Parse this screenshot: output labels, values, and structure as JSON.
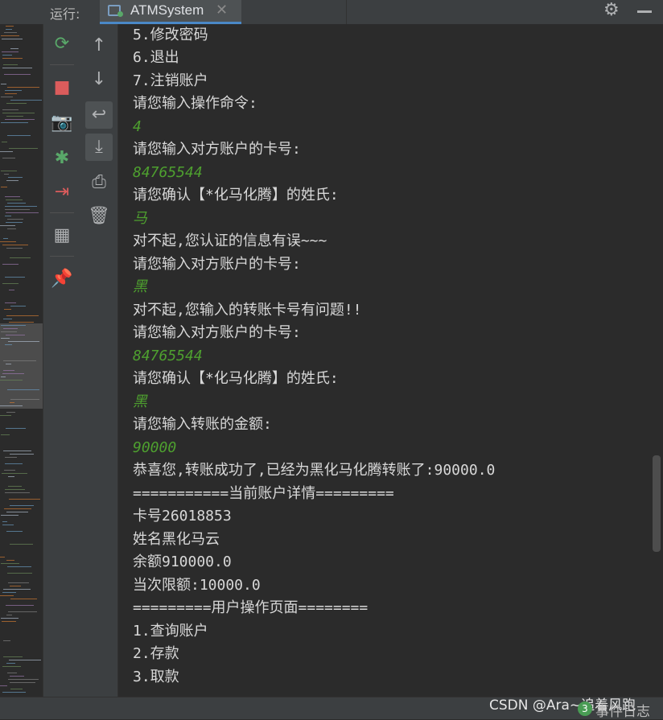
{
  "toolbar": {
    "run_label": "运行:",
    "tab_title": "ATMSystem",
    "tab_close": "✕"
  },
  "left_tools": [
    {
      "name": "rerun-icon",
      "glyph": "⟳",
      "color": "#59a869"
    },
    {
      "name": "stop-icon",
      "glyph": "■",
      "color": "#db5c5c"
    },
    {
      "name": "camera-icon",
      "glyph": "📷",
      "color": "#afb1b3"
    },
    {
      "name": "debug-icon",
      "glyph": "✱",
      "color": "#59a869"
    },
    {
      "name": "exit-icon",
      "glyph": "⇥",
      "color": "#db5c5c"
    },
    {
      "name": "layout-icon",
      "glyph": "▦",
      "color": "#afb1b3"
    },
    {
      "name": "pin-icon",
      "glyph": "📌",
      "color": "#afb1b3"
    }
  ],
  "right_tools": [
    {
      "name": "arrow-up-icon",
      "glyph": "↑"
    },
    {
      "name": "arrow-down-icon",
      "glyph": "↓"
    },
    {
      "name": "soft-wrap-icon",
      "glyph": "↩"
    },
    {
      "name": "scroll-to-end-icon",
      "glyph": "⤓"
    },
    {
      "name": "print-icon",
      "glyph": "⎙"
    },
    {
      "name": "trash-icon",
      "glyph": "🗑"
    }
  ],
  "console_lines": [
    {
      "text": "5.修改密码",
      "input": false
    },
    {
      "text": "6.退出",
      "input": false
    },
    {
      "text": "7.注销账户",
      "input": false
    },
    {
      "text": "请您输入操作命令:",
      "input": false
    },
    {
      "text": "4",
      "input": true
    },
    {
      "text": "请您输入对方账户的卡号:",
      "input": false
    },
    {
      "text": "84765544",
      "input": true
    },
    {
      "text": "请您确认【*化马化腾】的姓氏:",
      "input": false
    },
    {
      "text": "马",
      "input": true
    },
    {
      "text": "对不起,您认证的信息有误~~~",
      "input": false
    },
    {
      "text": "请您输入对方账户的卡号:",
      "input": false
    },
    {
      "text": "黑",
      "input": true
    },
    {
      "text": "对不起,您输入的转账卡号有问题!!",
      "input": false
    },
    {
      "text": "请您输入对方账户的卡号:",
      "input": false
    },
    {
      "text": "84765544",
      "input": true
    },
    {
      "text": "请您确认【*化马化腾】的姓氏:",
      "input": false
    },
    {
      "text": "黑",
      "input": true
    },
    {
      "text": "请您输入转账的金额:",
      "input": false
    },
    {
      "text": "90000",
      "input": true
    },
    {
      "text": "恭喜您,转账成功了,已经为黑化马化腾转账了:90000.0",
      "input": false
    },
    {
      "text": "===========当前账户详情=========",
      "input": false
    },
    {
      "text": "卡号26018853",
      "input": false
    },
    {
      "text": "姓名黑化马云",
      "input": false
    },
    {
      "text": "余额910000.0",
      "input": false
    },
    {
      "text": "当次限额:10000.0",
      "input": false
    },
    {
      "text": "=========用户操作页面========",
      "input": false
    },
    {
      "text": "1.查询账户",
      "input": false
    },
    {
      "text": "2.存款",
      "input": false
    },
    {
      "text": "3.取款",
      "input": false
    }
  ],
  "status": {
    "watermark": "CSDN @Ara~追着风跑",
    "event_count": "3",
    "event_label": "事件日志"
  }
}
